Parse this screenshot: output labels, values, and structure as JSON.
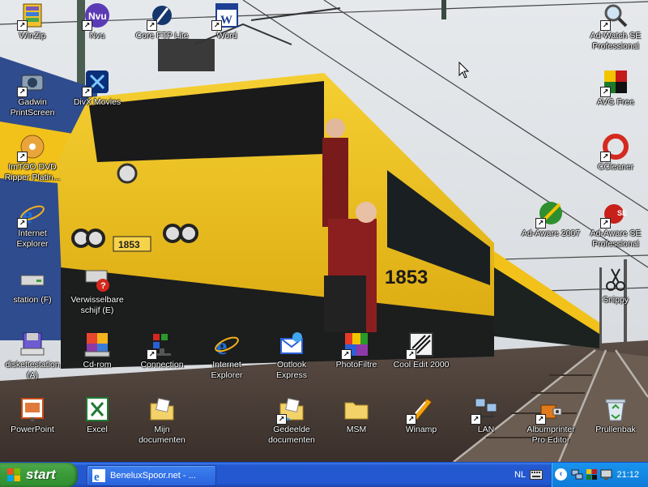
{
  "desktop": {
    "icons": [
      {
        "id": "winzip",
        "label": "WinZip",
        "glyph": "winzip-icon"
      },
      {
        "id": "nvu",
        "label": "Nvu",
        "glyph": "nvu-icon"
      },
      {
        "id": "coreftp",
        "label": "Core FTP Lite",
        "glyph": "ftp-icon"
      },
      {
        "id": "word",
        "label": "Word",
        "glyph": "word-icon"
      },
      {
        "id": "adwatch",
        "label": "Ad-Watch SE Professional",
        "glyph": "magnifier-icon"
      },
      {
        "id": "gadwin",
        "label": "Gadwin PrintScreen",
        "glyph": "camera-icon"
      },
      {
        "id": "divx",
        "label": "DivX Movies",
        "glyph": "divx-icon"
      },
      {
        "id": "avg",
        "label": "AVG Free",
        "glyph": "avg-icon"
      },
      {
        "id": "imtoo",
        "label": "ImTOO DVD Ripper Platin...",
        "glyph": "dvd-icon"
      },
      {
        "id": "ccleaner",
        "label": "CCleaner",
        "glyph": "ccleaner-icon"
      },
      {
        "id": "ie1",
        "label": "Internet Explorer",
        "glyph": "ie-icon"
      },
      {
        "id": "adaware2007",
        "label": "Ad-Aware 2007",
        "glyph": "adaware-icon"
      },
      {
        "id": "adawarese",
        "label": "Ad-Aware SE Professional",
        "glyph": "adaware-se-icon"
      },
      {
        "id": "station",
        "label": "station (F)",
        "glyph": "drive-icon"
      },
      {
        "id": "removable",
        "label": "Verwisselbare schijf (E)",
        "glyph": "removable-drive-icon"
      },
      {
        "id": "snippy",
        "label": "Snippy",
        "glyph": "scissors-icon"
      },
      {
        "id": "floppy",
        "label": "diskettestation (A)",
        "glyph": "floppy-icon"
      },
      {
        "id": "cdrom",
        "label": "Cd-rom",
        "glyph": "cdrom-icon"
      },
      {
        "id": "connection",
        "label": "Connection",
        "glyph": "connection-icon"
      },
      {
        "id": "ie2",
        "label": "Internet Explorer",
        "glyph": "ie-icon"
      },
      {
        "id": "outlook",
        "label": "Outlook Express",
        "glyph": "outlook-icon"
      },
      {
        "id": "photofiltre",
        "label": "PhotoFiltre",
        "glyph": "photofiltre-icon"
      },
      {
        "id": "cooledit",
        "label": "Cool Edit 2000",
        "glyph": "cooledit-icon"
      },
      {
        "id": "powerpoint",
        "label": "PowerPoint",
        "glyph": "powerpoint-icon"
      },
      {
        "id": "excel",
        "label": "Excel",
        "glyph": "excel-icon"
      },
      {
        "id": "mydocs",
        "label": "Mijn documenten",
        "glyph": "my-documents-icon"
      },
      {
        "id": "shareddocs",
        "label": "Gedeelde documenten",
        "glyph": "shared-documents-icon"
      },
      {
        "id": "msm",
        "label": "MSM",
        "glyph": "folder-icon"
      },
      {
        "id": "winamp",
        "label": "Winamp",
        "glyph": "winamp-icon"
      },
      {
        "id": "lan",
        "label": "LAN",
        "glyph": "network-icon"
      },
      {
        "id": "albumprinter",
        "label": "Albumprinter Pro Editor",
        "glyph": "albumprinter-icon"
      },
      {
        "id": "recycle",
        "label": "Prullenbak",
        "glyph": "recycle-bin-icon"
      }
    ],
    "wallpaper": {
      "locomotive_number": "1853"
    }
  },
  "taskbar": {
    "start_label": "start",
    "task_label": "BeneluxSpoor.net - ...",
    "language": "NL",
    "clock": "21:12"
  },
  "colors": {
    "taskbar_blue": "#2458d0",
    "start_green": "#3b9b3a",
    "tray_blue": "#138be4",
    "loco_yellow": "#f2c21a"
  }
}
